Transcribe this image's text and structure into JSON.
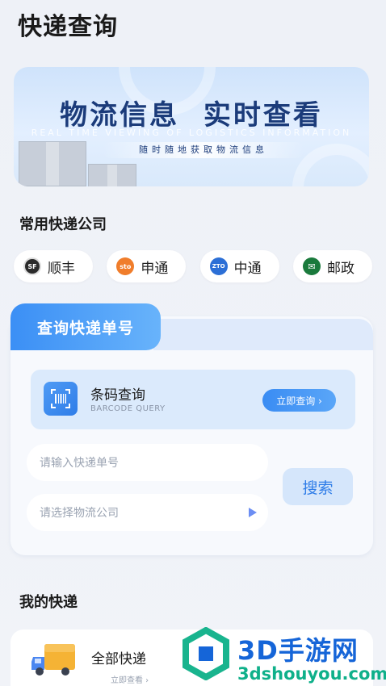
{
  "header": {
    "title": "快递查询"
  },
  "banner": {
    "title": "物流信息  实时查看",
    "subtitle": "REAL TIME VIEWING OF LOGISTICS INFORMATION",
    "tagline": "随时随地获取物流信息"
  },
  "companies": {
    "heading": "常用快递公司",
    "items": [
      {
        "name": "顺丰",
        "logo_text": "SF",
        "color": "#2b2b2b"
      },
      {
        "name": "申通",
        "logo_text": "sto",
        "color": "#f07d2b"
      },
      {
        "name": "中通",
        "logo_text": "ZTO",
        "color": "#2c6fd6"
      },
      {
        "name": "邮政",
        "logo_text": "✉",
        "color": "#1a7a3c"
      }
    ]
  },
  "query": {
    "tab_label": "查询快递单号",
    "barcode": {
      "title": "条码查询",
      "subtitle": "BARCODE QUERY",
      "button_label": "立即查询 ›"
    },
    "tracking_input": {
      "placeholder": "请输入快递单号"
    },
    "company_select": {
      "placeholder": "请选择物流公司"
    },
    "search_label": "搜索"
  },
  "my_packages": {
    "heading": "我的快递",
    "card_title": "全部快递",
    "card_link": "立即查看 ›"
  },
  "watermark": {
    "title": "3D手游网",
    "url": "3dshouyou.com"
  },
  "colors": {
    "accent": "#3b8ff5",
    "banner_title": "#1b3b7a"
  }
}
